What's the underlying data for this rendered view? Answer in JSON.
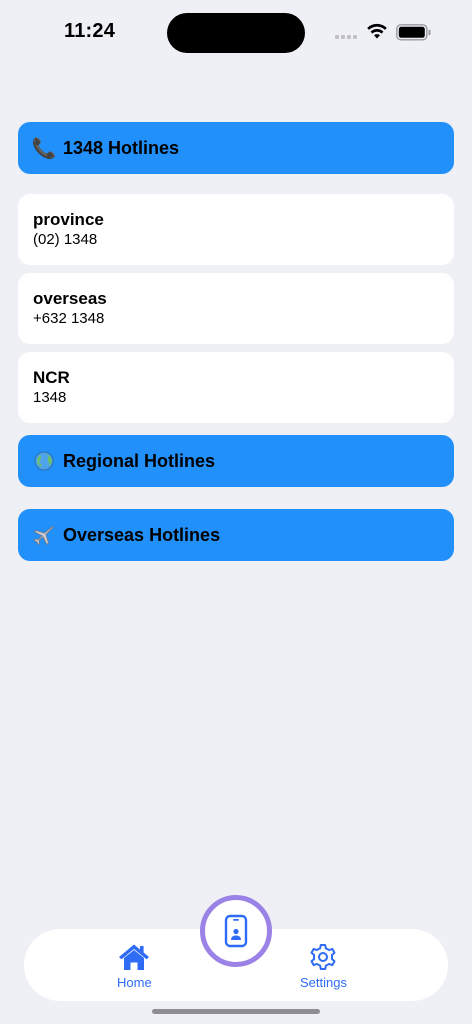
{
  "status_bar": {
    "time": "11:24"
  },
  "sections": {
    "hotlines_1348": {
      "emoji": "📞",
      "label": "1348 Hotlines"
    },
    "regional": {
      "emoji": "🌐",
      "label": "Regional Hotlines"
    },
    "overseas": {
      "emoji": "✈️",
      "label": "Overseas Hotlines"
    }
  },
  "hotline_items": [
    {
      "title": "province",
      "number": "(02) 1348"
    },
    {
      "title": "overseas",
      "number": "+632 1348"
    },
    {
      "title": "NCR",
      "number": "1348"
    }
  ],
  "tab_bar": {
    "home_label": "Home",
    "settings_label": "Settings",
    "home_icon": "house-icon",
    "settings_icon": "gear-icon",
    "center_icon": "phone-contact-icon"
  },
  "colors": {
    "background": "#eff0f5",
    "section_header": "#2290fa",
    "tab_accent": "#2f6cf6",
    "center_ring": "#9b82e6"
  }
}
